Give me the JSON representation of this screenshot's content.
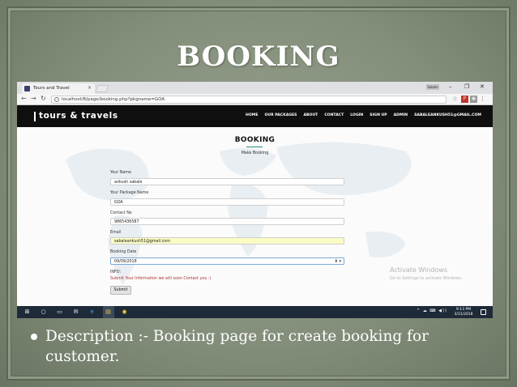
{
  "slide": {
    "title": "BOOKING",
    "caption": "Description :- Booking page for create booking for customer."
  },
  "browser": {
    "tab_title": "Tours and Travel",
    "tab_close": "×",
    "profile_label": "Sabale",
    "window_controls": [
      "–",
      "❐",
      "✕"
    ],
    "url": "localhost/8/page/booking.php?pkgname=GOA",
    "nav_icons": [
      "back-arrow-icon",
      "forward-arrow-icon",
      "reload-icon"
    ]
  },
  "site": {
    "logo": "tours & travels",
    "nav": [
      "HOME",
      "OUR PACKAGES",
      "ABOUT",
      "CONTACT",
      "LOGIN",
      "SIGN UP",
      "ADMIN",
      "SABALEANKUSH51@GMAIL.COM"
    ]
  },
  "form": {
    "heading": "BOOKING",
    "subheading": "Make Booking",
    "name_label": "Your Name",
    "name_value": "ankush sabale",
    "package_label": "Your Package Name",
    "package_value": "GOA",
    "contact_label": "Contact No",
    "contact_value": "9865436587",
    "email_label": "Email",
    "email_value": "sabaleankush51@gmail.com",
    "date_label": "Booking Date",
    "date_value": "09/09/2018",
    "info_label": "INFO:",
    "info_message": "Submit Your Information we will soon Contact you :)",
    "submit_label": "Submit"
  },
  "watermark": {
    "line1": "Activate Windows",
    "line2": "Go to Settings to activate Windows."
  },
  "taskbar": {
    "time": "9:13 PM",
    "date": "3/31/2018",
    "tray": "^ ☁ ⌨ ◀))"
  },
  "colors": {
    "slide_bg": "#8a9581",
    "navbar": "#0f0f0f",
    "accent": "#2a8a7c",
    "info_text": "#b03030",
    "email_highlight": "#fafcc3",
    "taskbar": "#1e2a38"
  }
}
